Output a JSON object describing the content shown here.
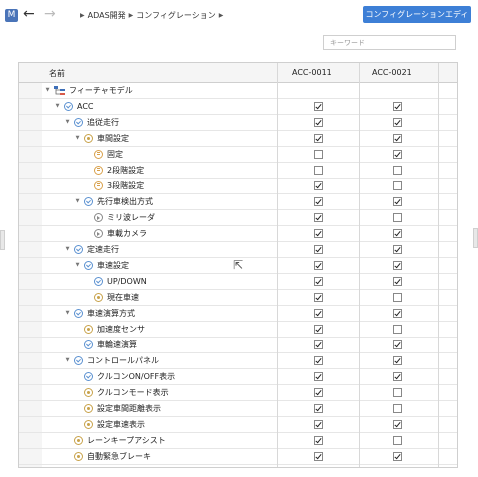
{
  "header": {
    "badge": "M",
    "back_glyph": "←",
    "forward_glyph": "→",
    "breadcrumbs": [
      "ADAS開発",
      "コンフィグレーション"
    ],
    "config_editor_button": "コンフィグレーションエディタ",
    "search_placeholder": "キーワード"
  },
  "table": {
    "columns": [
      "名前",
      "ACC-0011",
      "ACC-0021"
    ],
    "rows": [
      {
        "label": "フィーチャモデル",
        "indent": 0,
        "icon": "model",
        "toggle": "down",
        "c1": null,
        "c2": null
      },
      {
        "label": "ACC",
        "indent": 1,
        "icon": "check",
        "toggle": "down",
        "c1": true,
        "c2": true
      },
      {
        "label": "追従走行",
        "indent": 2,
        "icon": "check",
        "toggle": "down",
        "c1": true,
        "c2": true
      },
      {
        "label": "車間設定",
        "indent": 3,
        "icon": "dot",
        "toggle": "down",
        "c1": true,
        "c2": true
      },
      {
        "label": "固定",
        "indent": 4,
        "icon": "eq",
        "toggle": "",
        "c1": false,
        "c2": true
      },
      {
        "label": "2段階設定",
        "indent": 4,
        "icon": "eq",
        "toggle": "",
        "c1": false,
        "c2": false
      },
      {
        "label": "3段階設定",
        "indent": 4,
        "icon": "eq",
        "toggle": "",
        "c1": true,
        "c2": false
      },
      {
        "label": "先行車検出方式",
        "indent": 3,
        "icon": "check",
        "toggle": "down",
        "c1": true,
        "c2": true
      },
      {
        "label": "ミリ波レーダ",
        "indent": 4,
        "icon": "arr",
        "toggle": "",
        "c1": true,
        "c2": false
      },
      {
        "label": "車載カメラ",
        "indent": 4,
        "icon": "arr",
        "toggle": "",
        "c1": true,
        "c2": true
      },
      {
        "label": "定速走行",
        "indent": 2,
        "icon": "check",
        "toggle": "down",
        "c1": true,
        "c2": true
      },
      {
        "label": "車速設定",
        "indent": 3,
        "icon": "check",
        "toggle": "down",
        "c1": true,
        "c2": true
      },
      {
        "label": "UP/DOWN",
        "indent": 4,
        "icon": "check",
        "toggle": "",
        "c1": true,
        "c2": true
      },
      {
        "label": "現在車速",
        "indent": 4,
        "icon": "dot",
        "toggle": "",
        "c1": true,
        "c2": false
      },
      {
        "label": "車速演算方式",
        "indent": 2,
        "icon": "check",
        "toggle": "down",
        "c1": true,
        "c2": true
      },
      {
        "label": "加速度センサ",
        "indent": 3,
        "icon": "dot",
        "toggle": "",
        "c1": true,
        "c2": false
      },
      {
        "label": "車輪速演算",
        "indent": 3,
        "icon": "check",
        "toggle": "",
        "c1": true,
        "c2": true
      },
      {
        "label": "コントロールパネル",
        "indent": 2,
        "icon": "check",
        "toggle": "down",
        "c1": true,
        "c2": true
      },
      {
        "label": "クルコンON/OFF表示",
        "indent": 3,
        "icon": "check",
        "toggle": "",
        "c1": true,
        "c2": true
      },
      {
        "label": "クルコンモード表示",
        "indent": 3,
        "icon": "dot",
        "toggle": "",
        "c1": true,
        "c2": false
      },
      {
        "label": "設定車間距離表示",
        "indent": 3,
        "icon": "dot",
        "toggle": "",
        "c1": true,
        "c2": false
      },
      {
        "label": "設定車速表示",
        "indent": 3,
        "icon": "dot",
        "toggle": "",
        "c1": true,
        "c2": true
      },
      {
        "label": "レーンキープアシスト",
        "indent": 2,
        "icon": "dot",
        "toggle": "",
        "c1": true,
        "c2": false
      },
      {
        "label": "自動緊急ブレーキ",
        "indent": 2,
        "icon": "dot",
        "toggle": "",
        "c1": true,
        "c2": true
      }
    ]
  },
  "colors": {
    "accent": "#3d7fd6",
    "check_icon": "#5a90d0",
    "dot_icon": "#c8a24a"
  }
}
